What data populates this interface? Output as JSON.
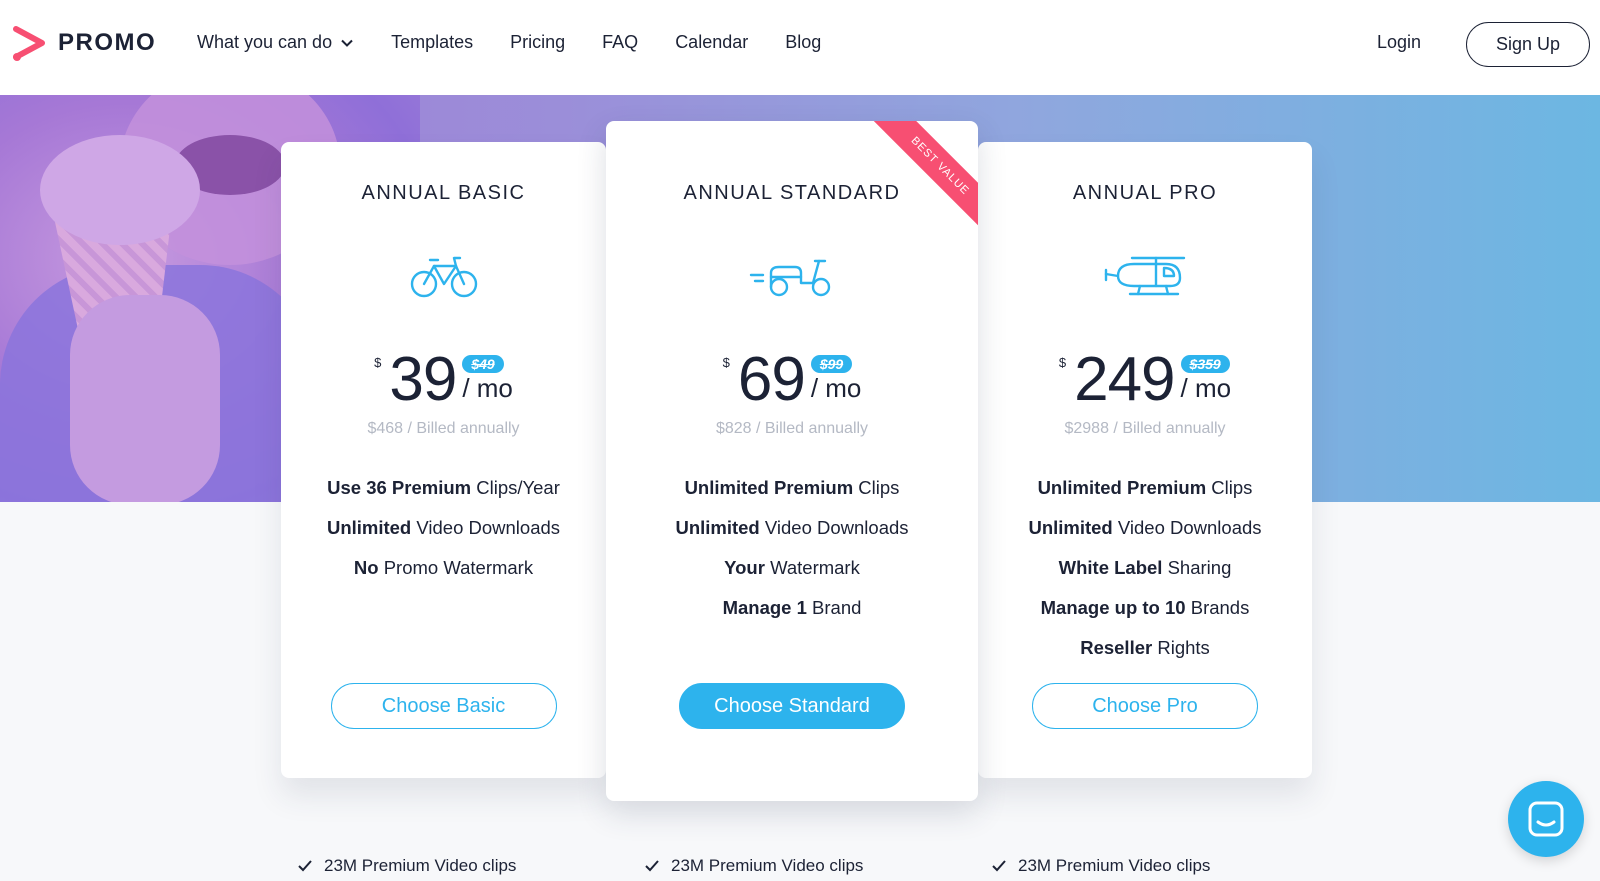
{
  "brand": {
    "name": "PROMO",
    "accent": "#f74f72",
    "primary": "#2db3ed",
    "text": "#1c2235"
  },
  "nav": {
    "links": [
      "What you can do",
      "Templates",
      "Pricing",
      "FAQ",
      "Calendar",
      "Blog"
    ],
    "login": "Login",
    "signup": "Sign Up"
  },
  "plans": [
    {
      "title": "ANNUAL BASIC",
      "icon": "bicycle-icon",
      "currency": "$",
      "price": "39",
      "old_price": "$49",
      "per": "/ mo",
      "billed": "$468 / Billed annually",
      "features": [
        {
          "bold": "Use 36 Premium",
          "rest": " Clips/Year"
        },
        {
          "bold": "Unlimited",
          "rest": " Video Downloads"
        },
        {
          "bold": "No",
          "rest": " Promo Watermark"
        }
      ],
      "cta": "Choose Basic"
    },
    {
      "title": "ANNUAL STANDARD",
      "icon": "scooter-icon",
      "ribbon": "BEST VALUE",
      "currency": "$",
      "price": "69",
      "old_price": "$99",
      "per": "/ mo",
      "billed": "$828 / Billed annually",
      "features": [
        {
          "bold": "Unlimited Premium",
          "rest": " Clips"
        },
        {
          "bold": "Unlimited",
          "rest": " Video Downloads"
        },
        {
          "bold": "Your",
          "rest": " Watermark"
        },
        {
          "bold": "Manage 1",
          "rest": " Brand"
        }
      ],
      "cta": "Choose Standard"
    },
    {
      "title": "ANNUAL PRO",
      "icon": "helicopter-icon",
      "currency": "$",
      "price": "249",
      "old_price": "$359",
      "per": "/ mo",
      "billed": "$2988 / Billed annually",
      "features": [
        {
          "bold": "Unlimited Premium",
          "rest": " Clips"
        },
        {
          "bold": "Unlimited",
          "rest": " Video Downloads"
        },
        {
          "bold": "White Label",
          "rest": " Sharing"
        },
        {
          "bold": "Manage up to 10",
          "rest": " Brands"
        },
        {
          "bold": "Reseller",
          "rest": " Rights"
        }
      ],
      "cta": "Choose Pro"
    }
  ],
  "bottom": [
    "23M Premium Video clips",
    "23M Premium Video clips",
    "23M Premium Video clips"
  ]
}
